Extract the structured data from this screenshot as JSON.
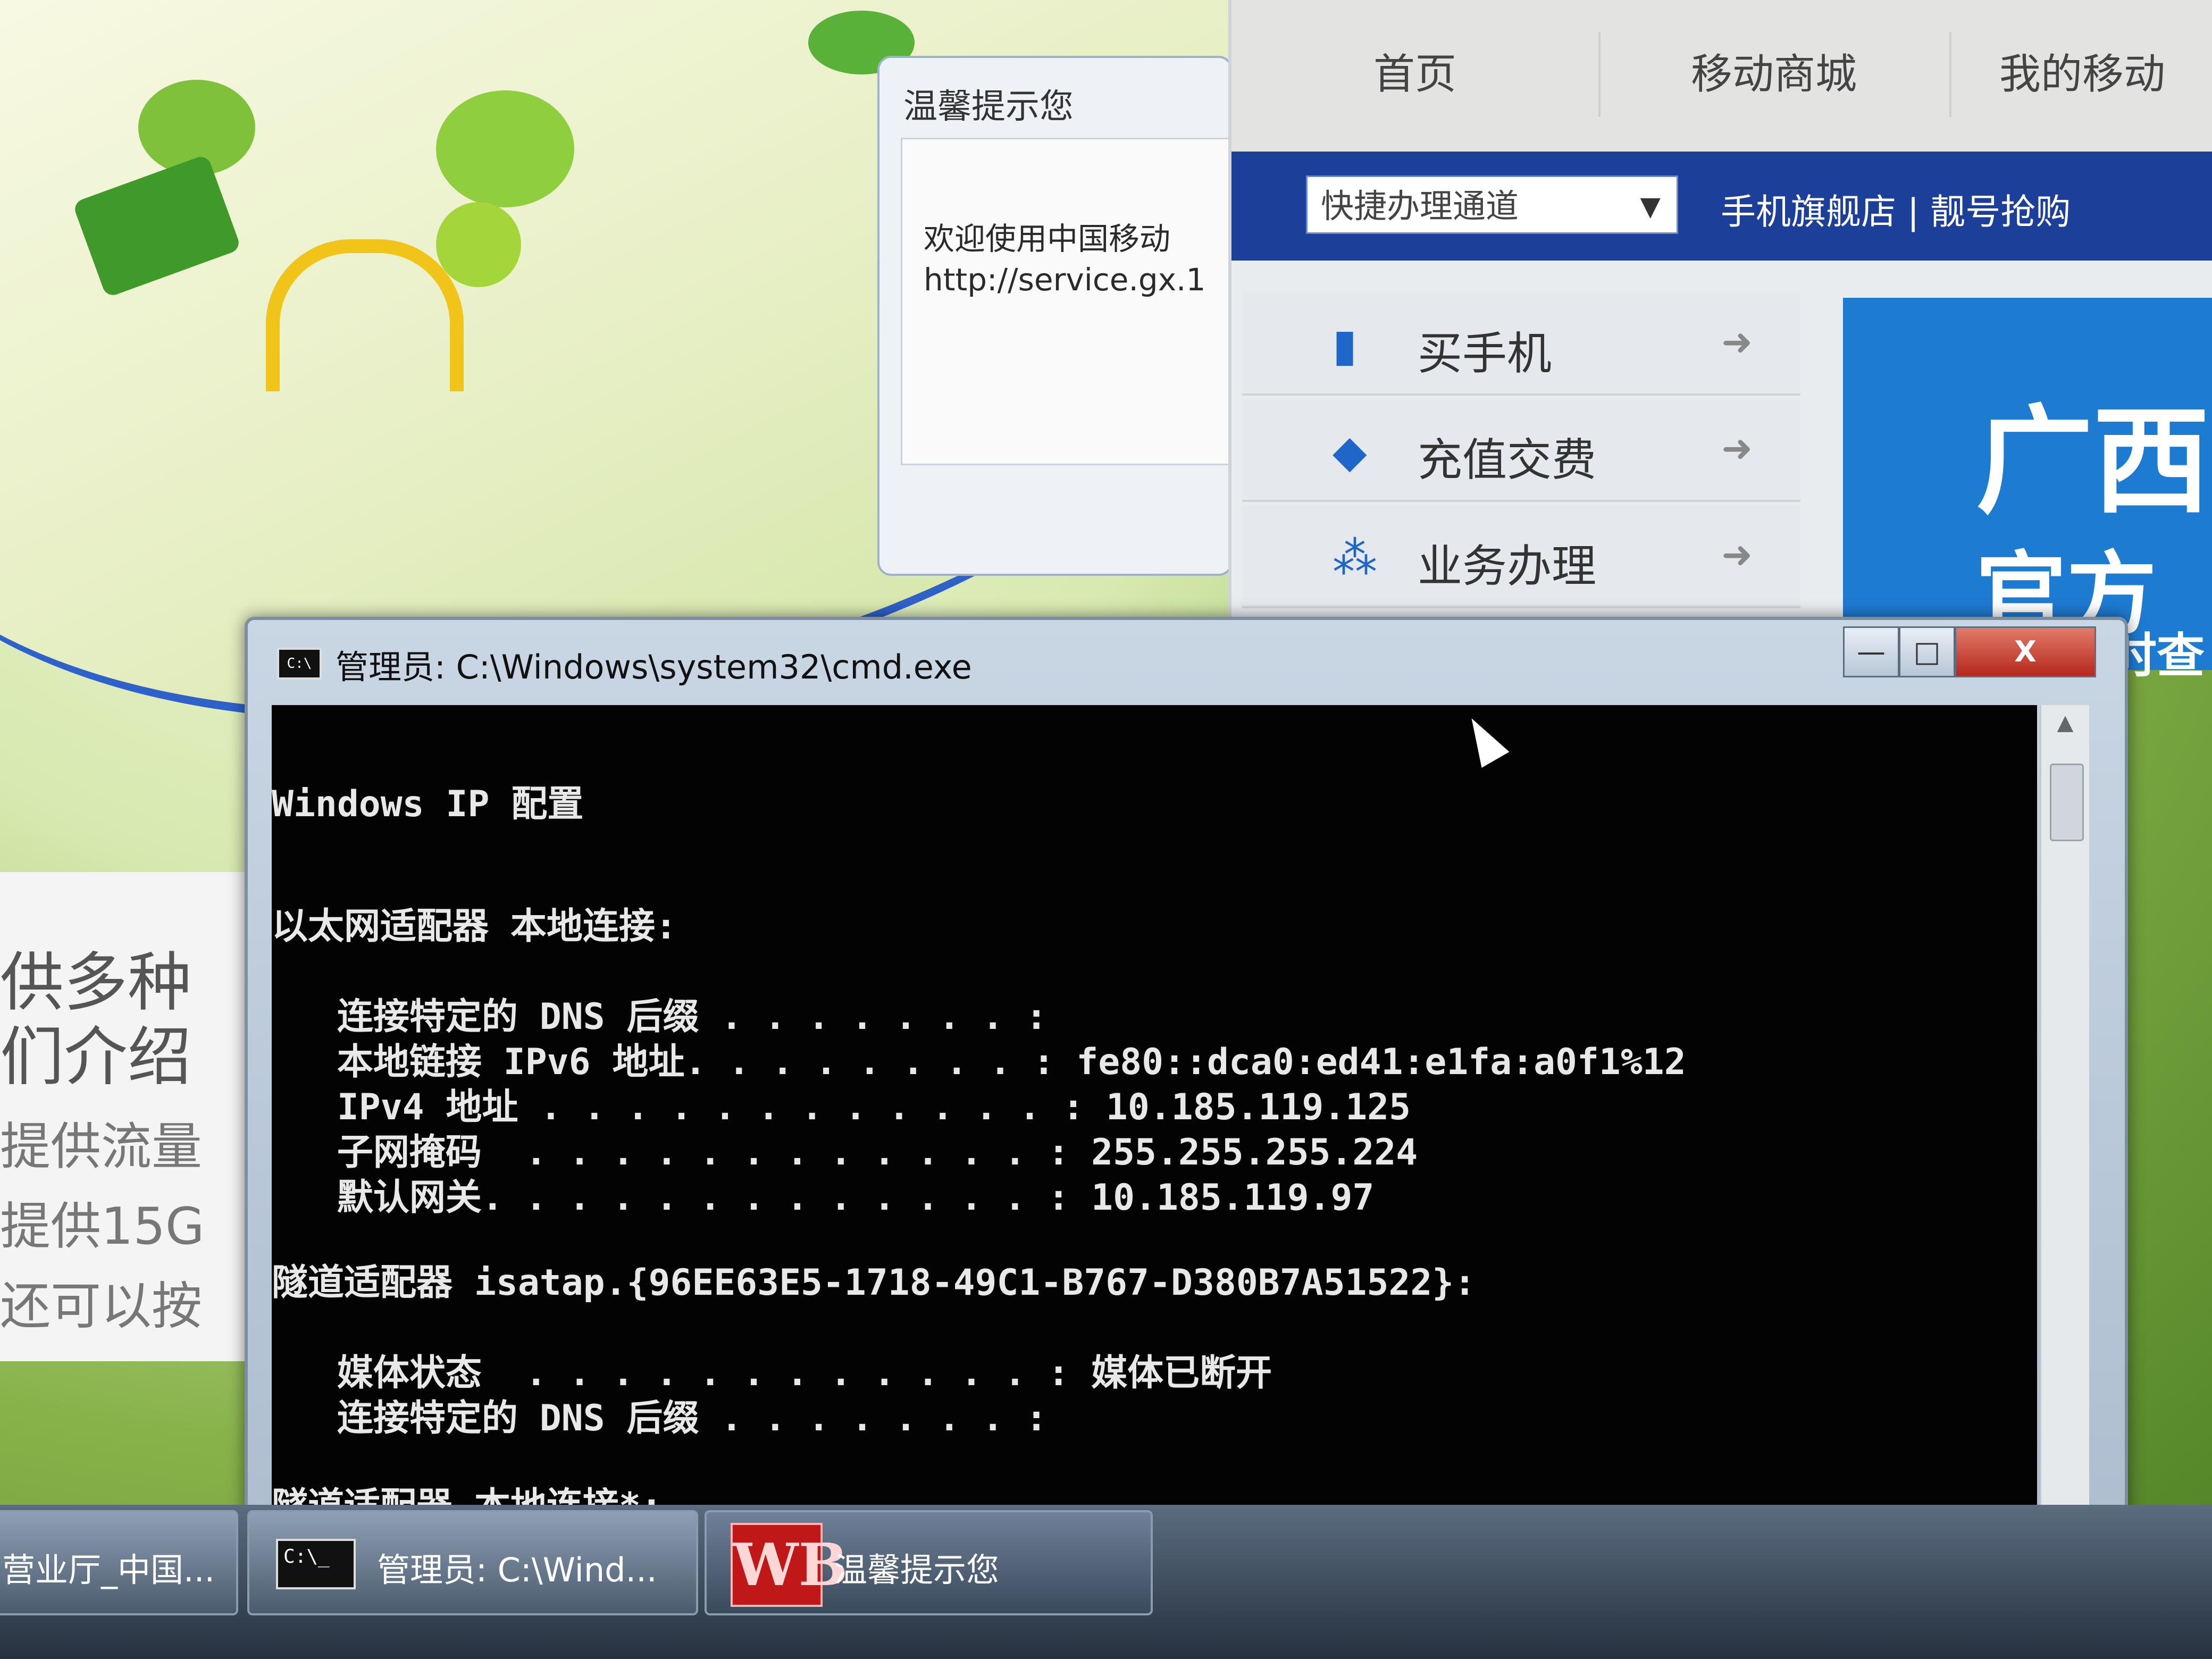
{
  "notice_dialog": {
    "title": "温馨提示您",
    "body_line1": "欢迎使用中国移动",
    "body_line2": "http://service.gx.1"
  },
  "web_page": {
    "nav": [
      "首页",
      "移动商城",
      "我的移动"
    ],
    "quick_select_value": "快捷办理通道",
    "quick_links": "手机旗舰店 | 靓号抢购",
    "menu": [
      {
        "label": "买手机",
        "icon": "phone-icon"
      },
      {
        "label": "充值交费",
        "icon": "card-icon"
      },
      {
        "label": "业务办理",
        "icon": "network-icon"
      }
    ],
    "banner_text": [
      "广西",
      "官方",
      "时查"
    ]
  },
  "left_page": {
    "lines": [
      "供多种",
      "们介绍",
      "提供流量",
      "提供15G",
      "还可以按"
    ]
  },
  "cmd_window": {
    "title": "管理员: C:\\Windows\\system32\\cmd.exe",
    "icon_text": "C:\\",
    "controls": {
      "minimize": "—",
      "maximize": "□",
      "close": "X"
    },
    "lines": [
      "Windows IP 配置",
      "以太网适配器 本地连接:",
      "   连接特定的 DNS 后缀 . . . . . . . :",
      "   本地链接 IPv6 地址. . . . . . . . : fe80::dca0:ed41:e1fa:a0f1%12",
      "   IPv4 地址 . . . . . . . . . . . . : 10.185.119.125",
      "   子网掩码  . . . . . . . . . . . . : 255.255.255.224",
      "   默认网关. . . . . . . . . . . . . : 10.185.119.97",
      "隧道适配器 isatap.{96EE63E5-1718-49C1-B767-D380B7A51522}:",
      "   媒体状态  . . . . . . . . . . . . : 媒体已断开",
      "   连接特定的 DNS 后缀 . . . . . . . :",
      "隧道适配器 本地连接*:"
    ]
  },
  "taskbar": {
    "items": [
      {
        "label": "营业厅_中国..."
      },
      {
        "label": "管理员: C:\\Wind...",
        "icon_text": "C:\\_"
      },
      {
        "label": "温馨提示您",
        "icon_text": "WB"
      }
    ]
  },
  "colors": {
    "console_bg": "#030303",
    "console_text": "#e8e8e8",
    "web_bluebar": "#1c3f9a",
    "close_button": "#b5281b"
  }
}
